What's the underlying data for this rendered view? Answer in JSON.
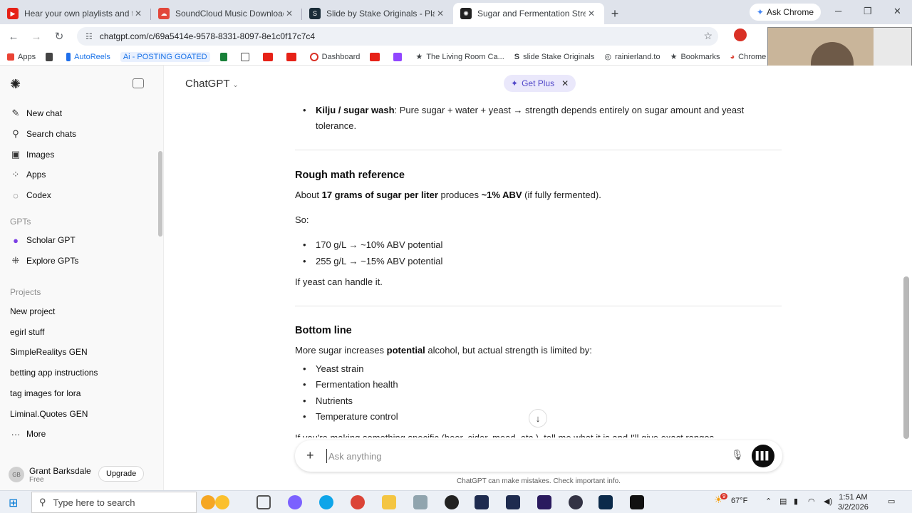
{
  "browser": {
    "tabs": [
      {
        "title": "Hear your own playlists and the",
        "color": "#e62117"
      },
      {
        "title": "SoundCloud Music Downloader",
        "color": "#e2463a"
      },
      {
        "title": "Slide by Stake Originals - Play F",
        "color": "#1a2c38"
      },
      {
        "title": "Sugar and Fermentation Streng",
        "color": "#222222"
      }
    ],
    "ask_chrome": "Ask Chrome",
    "url": "chatgpt.com/c/69a5414e-9578-8331-8097-8e1c0f17c7c4",
    "bookmarks": [
      {
        "label": "Apps"
      },
      {
        "label": ""
      },
      {
        "label": "AutoReels"
      },
      {
        "label": "Ai - POSTING GOATED"
      },
      {
        "label": ""
      },
      {
        "label": ""
      },
      {
        "label": ""
      },
      {
        "label": ""
      },
      {
        "label": "Dashboard"
      },
      {
        "label": ""
      },
      {
        "label": ""
      },
      {
        "label": "The Living Room Ca..."
      },
      {
        "label": "slide Stake Originals"
      },
      {
        "label": "rainierland.to"
      },
      {
        "label": "Bookmarks"
      },
      {
        "label": "Chrome We"
      }
    ]
  },
  "sidebar": {
    "nav": [
      {
        "label": "New chat",
        "icon": "edit-icon"
      },
      {
        "label": "Search chats",
        "icon": "search-icon"
      },
      {
        "label": "Images",
        "icon": "image-icon"
      },
      {
        "label": "Apps",
        "icon": "apps-icon"
      },
      {
        "label": "Codex",
        "icon": "code-icon"
      }
    ],
    "gpts_heading": "GPTs",
    "gpts": [
      {
        "label": "Scholar GPT"
      },
      {
        "label": "Explore GPTs"
      }
    ],
    "projects_heading": "Projects",
    "projects": [
      {
        "label": "New project"
      },
      {
        "label": "egirl stuff"
      },
      {
        "label": "SimpleRealitys GEN"
      },
      {
        "label": "betting app instructions"
      },
      {
        "label": "tag images for lora"
      },
      {
        "label": "Liminal.Quotes GEN"
      },
      {
        "label": "More"
      }
    ],
    "user": {
      "initials": "GB",
      "name": "Grant Barksdale",
      "plan": "Free",
      "upgrade": "Upgrade"
    }
  },
  "header": {
    "brand": "ChatGPT",
    "get_plus": "Get Plus"
  },
  "chat": {
    "kilju_label": "Kilju / sugar wash",
    "kilju_text": ": Pure sugar + water + yeast → strength depends entirely on sugar amount and yeast",
    "kilju_text2": "tolerance.",
    "math_heading": "Rough math reference",
    "math_pre": "About ",
    "math_bold1": "17 grams of sugar per liter",
    "math_mid": " produces ",
    "math_bold2": "~1% ABV",
    "math_post": " (if fully fermented).",
    "so": "So:",
    "math_list": [
      "170 g/L → ~10% ABV potential",
      "255 g/L → ~15% ABV potential"
    ],
    "yeast_note": "If yeast can handle it.",
    "bottom_heading": "Bottom line",
    "bottom_pre": "More sugar increases ",
    "bottom_bold": "potential",
    "bottom_post": " alcohol, but actual strength is limited by:",
    "factors": [
      "Yeast strain",
      "Fermentation health",
      "Nutrients",
      "Temperature control"
    ],
    "final": "If you're making something specific (beer, cider, mead, etc.), tell me what it is and I'll give exact ranges."
  },
  "composer": {
    "placeholder": "Ask anything",
    "disclaimer": "ChatGPT can make mistakes. Check important info."
  },
  "taskbar": {
    "search_placeholder": "Type here to search",
    "weather": "67°F",
    "time": "1:51 AM",
    "date": "3/2/2026",
    "notifications": "9"
  }
}
